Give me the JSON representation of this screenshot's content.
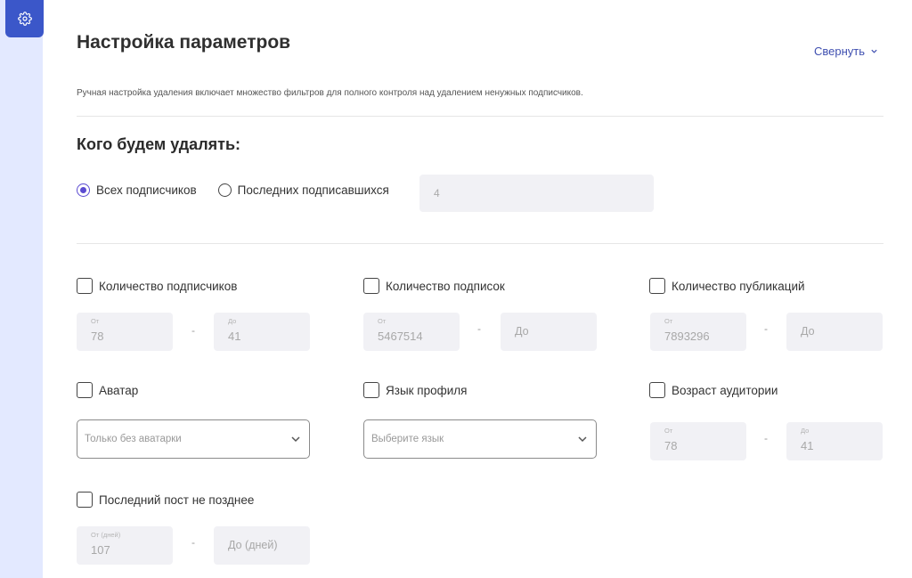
{
  "sidebar": {
    "icon": "gear-icon"
  },
  "header": {
    "title": "Настройка параметров",
    "collapse_label": "Свернуть",
    "description": "Ручная настройка удаления включает множество фильтров для полного контроля над удалением ненужных подписчиков."
  },
  "target": {
    "title": "Кого будем удалять:",
    "all_label": "Всех подписчиков",
    "recent_label": "Последних подписавшихся",
    "recent_count": "4",
    "selected": "all"
  },
  "filters": {
    "followers": {
      "label": "Количество подписчиков",
      "from_label": "От",
      "from_value": "78",
      "to_label": "До",
      "to_value": "41"
    },
    "following": {
      "label": "Количество подписок",
      "from_label": "От",
      "from_value": "5467514",
      "to_placeholder": "До"
    },
    "posts": {
      "label": "Количество публикаций",
      "from_label": "От",
      "from_value": "7893296",
      "to_placeholder": "До"
    },
    "avatar": {
      "label": "Аватар",
      "select_value": "Только без аватарки"
    },
    "language": {
      "label": "Язык профиля",
      "select_placeholder": "Выберите язык"
    },
    "audience_age": {
      "label": "Возраст аудитории",
      "from_label": "От",
      "from_value": "78",
      "to_label": "До",
      "to_value": "41"
    },
    "last_post": {
      "label": "Последний пост не позднее",
      "from_label": "От (дней)",
      "from_value": "107",
      "to_placeholder": "До (дней)"
    }
  },
  "range_separator": "-"
}
